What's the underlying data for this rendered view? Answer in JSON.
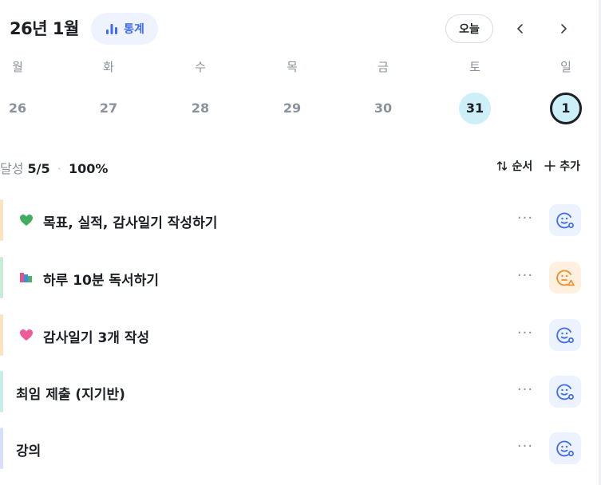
{
  "header": {
    "month_title": "26년 1월",
    "stats_label": "통계",
    "today_label": "오늘"
  },
  "week": [
    {
      "name": "월",
      "num": "26",
      "state": "normal"
    },
    {
      "name": "화",
      "num": "27",
      "state": "normal"
    },
    {
      "name": "수",
      "num": "28",
      "state": "normal"
    },
    {
      "name": "목",
      "num": "29",
      "state": "normal"
    },
    {
      "name": "금",
      "num": "30",
      "state": "normal"
    },
    {
      "name": "토",
      "num": "31",
      "state": "highlight"
    },
    {
      "name": "일",
      "num": "1",
      "state": "selected"
    }
  ],
  "summary": {
    "label": "달성",
    "count": "5/5",
    "separator": "·",
    "percent": "100%"
  },
  "actions": {
    "order_label": "순서",
    "add_label": "추가"
  },
  "tasks": [
    {
      "title": "목표, 실적, 감사일기 작성하기",
      "emoji": "green-heart-icon",
      "bar_color": "#fbe3c0",
      "status": "blue"
    },
    {
      "title": "하루 10분 독서하기",
      "emoji": "books-icon",
      "bar_color": "#c8ecd6",
      "status": "orange"
    },
    {
      "title": "감사일기 3개 작성",
      "emoji": "pink-heart-icon",
      "bar_color": "#fbe3c0",
      "status": "blue"
    },
    {
      "title": "최임 제출 (지기반)",
      "emoji": "",
      "bar_color": "#c6ede6",
      "status": "blue"
    },
    {
      "title": "강의",
      "emoji": "",
      "bar_color": "#d7defa",
      "status": "blue"
    }
  ],
  "colors": {
    "accent": "#3d6bf5",
    "highlight_day": "#cdeff8",
    "status_blue": "#3d6bf5",
    "status_orange": "#f28c28"
  }
}
